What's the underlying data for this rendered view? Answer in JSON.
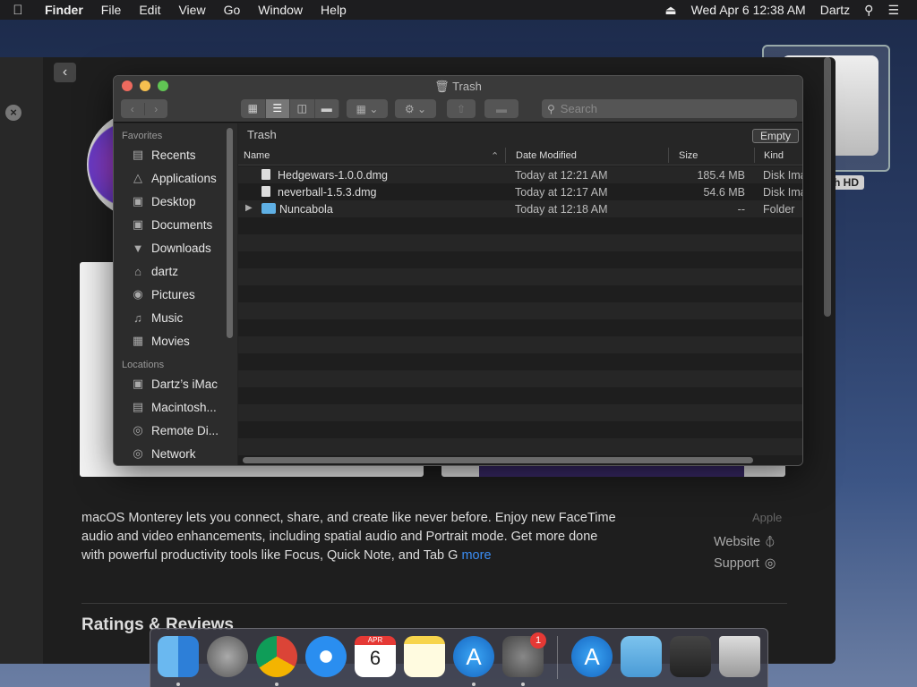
{
  "menubar": {
    "app_name": "Finder",
    "menus": [
      "File",
      "Edit",
      "View",
      "Go",
      "Window",
      "Help"
    ],
    "clock": "Wed Apr 6  12:38 AM",
    "user": "Dartz"
  },
  "appstore": {
    "description": "macOS Monterey lets you connect, share, and create like never before. Enjoy new FaceTime audio and video enhancements, including spatial audio and Portrait mode. Get more done with powerful productivity tools like Focus, Quick Note, and Tab G",
    "more_label": "more",
    "developer": "Apple",
    "website_label": "Website",
    "support_label": "Support",
    "ratings_heading": "Ratings & Reviews"
  },
  "desktop": {
    "hd_label": "h HD"
  },
  "finder": {
    "title": "Trash",
    "search_placeholder": "Search",
    "path": "Trash",
    "empty_label": "Empty",
    "sidebar": {
      "favorites_heading": "Favorites",
      "favorites": [
        {
          "label": "Recents",
          "icon": "recents-icon"
        },
        {
          "label": "Applications",
          "icon": "applications-icon"
        },
        {
          "label": "Desktop",
          "icon": "desktop-icon"
        },
        {
          "label": "Documents",
          "icon": "documents-icon"
        },
        {
          "label": "Downloads",
          "icon": "downloads-icon"
        },
        {
          "label": "dartz",
          "icon": "home-icon"
        },
        {
          "label": "Pictures",
          "icon": "pictures-icon"
        },
        {
          "label": "Music",
          "icon": "music-icon"
        },
        {
          "label": "Movies",
          "icon": "movies-icon"
        }
      ],
      "locations_heading": "Locations",
      "locations": [
        {
          "label": "Dartz’s iMac",
          "icon": "imac-icon"
        },
        {
          "label": "Macintosh...",
          "icon": "disk-icon"
        },
        {
          "label": "Remote Di...",
          "icon": "remote-disc-icon"
        },
        {
          "label": "Network",
          "icon": "network-icon"
        }
      ]
    },
    "columns": {
      "name": "Name",
      "date": "Date Modified",
      "size": "Size",
      "kind": "Kind"
    },
    "files": [
      {
        "name": "Hedgewars-1.0.0.dmg",
        "date": "Today at 12:21 AM",
        "size": "185.4 MB",
        "kind": "Disk Ima"
      },
      {
        "name": "neverball-1.5.3.dmg",
        "date": "Today at 12:17 AM",
        "size": "54.6 MB",
        "kind": "Disk Ima"
      },
      {
        "name": "Nuncabola",
        "date": "Today at 12:18 AM",
        "size": "--",
        "kind": "Folder"
      }
    ]
  },
  "dock": {
    "apps": [
      "Finder",
      "Launchpad",
      "Google Chrome",
      "Safari",
      "Calendar",
      "Notes",
      "App Store",
      "System Preferences",
      "App Store Downloads",
      "Downloads",
      "Screenshot",
      "Trash"
    ],
    "calendar_month": "APR",
    "calendar_day": "6",
    "sysprefs_badge": "1"
  }
}
